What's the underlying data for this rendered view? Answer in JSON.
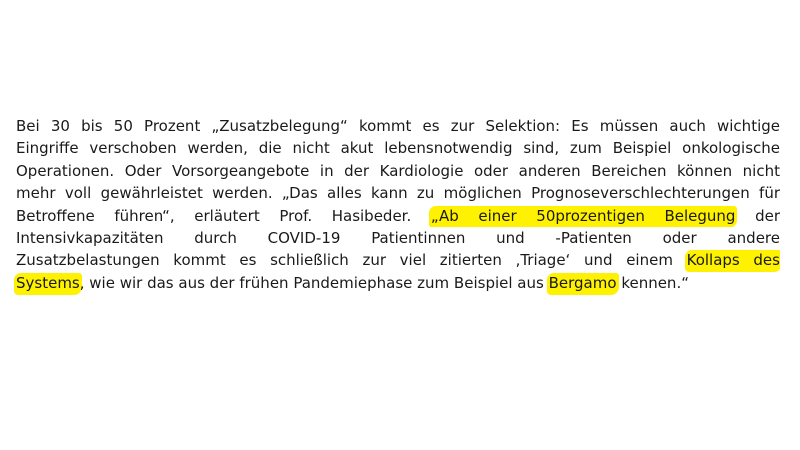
{
  "document": {
    "lines": [
      "Bei 30 bis 50 Prozent „Zusatzbelegung“ kommt es zur Selektion: Es müssen auch wichtige",
      "Eingriffe verschoben werden, die nicht akut lebensnotwendig sind, zum Beispiel onkologische",
      "Operationen. Oder Vorsorgeangebote in der Kardiologie oder anderen Bereichen können nicht",
      "mehr voll gewährleistet werden. „Das alles kann zu möglichen Prognoseverschlechterungen für"
    ],
    "line5": {
      "before": "Betroffene führen“, erläutert Prof. Hasibeder.",
      "highlight": "„Ab einer 50prozentigen Belegung",
      "after": "der"
    },
    "line6": "Intensivkapazitäten durch COVID-19 Patientinnen und -Patienten oder andere",
    "line7": {
      "before": "Zusatzbelastungen kommt es schließlich zur viel zitierten ‚Triage‘ und einem",
      "highlight": "Kollaps des"
    },
    "line8": {
      "highlight1": "Systems",
      "middle": ", wie wir das aus der frühen Pandemiephase zum Beispiel aus",
      "highlight2": "Bergamo",
      "after": "kennen.“"
    },
    "highlight_color": "#fff200",
    "text_color": "#1a1a1a"
  }
}
